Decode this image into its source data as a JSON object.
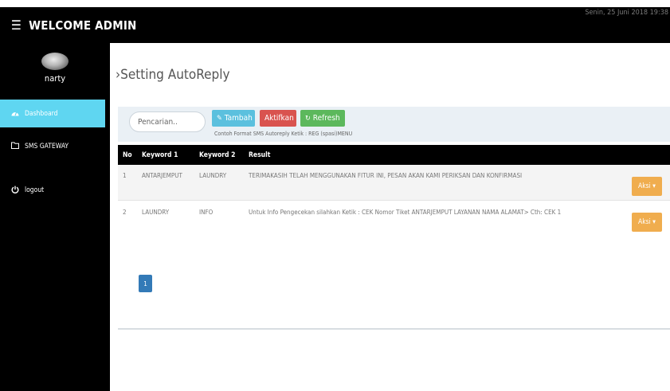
{
  "header": {
    "menu_icon": "hamburger-icon",
    "title": "WELCOME ADMIN",
    "datetime": "Senin, 25 Juni 2018 19:38"
  },
  "sidebar": {
    "username": "narty",
    "items": [
      {
        "label": "Dashboard",
        "icon": "dashboard-icon",
        "active": true
      },
      {
        "label": "SMS GATEWAY",
        "icon": "folder-icon",
        "active": false
      },
      {
        "label": "logout",
        "icon": "power-icon",
        "active": false
      }
    ]
  },
  "main": {
    "title": "›Setting AutoReply",
    "search": {
      "placeholder": "Pencarian..",
      "value": ""
    },
    "buttons": {
      "tambah": "Tambah",
      "aktifkan": "Aktifkan",
      "refresh": "Refresh"
    },
    "hint": "Contoh Format SMS Autoreply Ketik : REG (spasi)MENU",
    "table": {
      "headers": [
        "No",
        "Keyword 1",
        "Keyword 2",
        "Result"
      ],
      "rows": [
        {
          "no": "1",
          "k1": "ANTARJEMPUT",
          "k2": "LAUNDRY",
          "result": "TERIMAKASIH TELAH MENGGUNAKAN FITUR INI, PESAN AKAN KAMI PERIKSAN DAN KONFIRMASI",
          "action": "Aksi ▾"
        },
        {
          "no": "2",
          "k1": "LAUNDRY",
          "k2": "INFO",
          "result": "Untuk Info Pengecekan silahkan Ketik : CEK Nomor Tiket ANTARJEMPUT LAYANAN NAMA ALAMAT> Cth: CEK 1",
          "action": "Aksi ▾"
        }
      ]
    },
    "pagination": {
      "current": "1"
    }
  },
  "colors": {
    "sidebar_bg": "#000000",
    "active_nav": "#5fd6f1",
    "btn_tambah": "#5bc0de",
    "btn_aktifkan": "#d9534f",
    "btn_refresh": "#5cb85c",
    "btn_aksi": "#f0ad4e",
    "pager": "#337ab7"
  }
}
